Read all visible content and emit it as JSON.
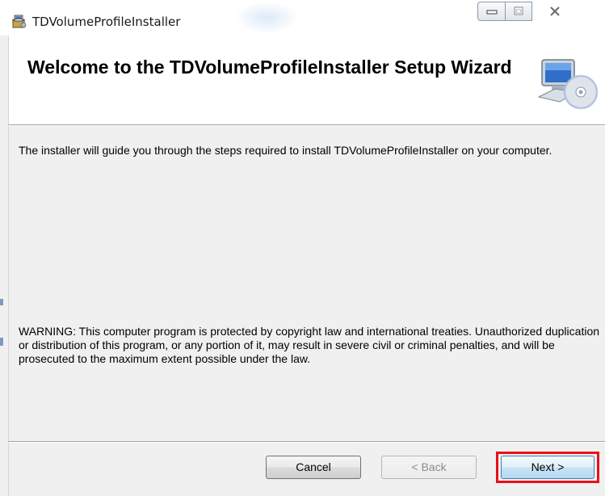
{
  "window": {
    "title": "TDVolumeProfileInstaller"
  },
  "header": {
    "title": "Welcome to the TDVolumeProfileInstaller Setup Wizard",
    "icon": "computer-cd-icon"
  },
  "body": {
    "intro": "The installer will guide you through the steps required to install TDVolumeProfileInstaller on your computer.",
    "warning": "WARNING: This computer program is protected by copyright law and international treaties. Unauthorized duplication or distribution of this program, or any portion of it, may result in severe civil or criminal penalties, and will be prosecuted to the maximum extent possible under the law."
  },
  "buttons": {
    "cancel": "Cancel",
    "back": "< Back",
    "next": "Next >"
  },
  "colors": {
    "highlight": "#e8101a",
    "dialog_bg": "#f0f0f0"
  }
}
